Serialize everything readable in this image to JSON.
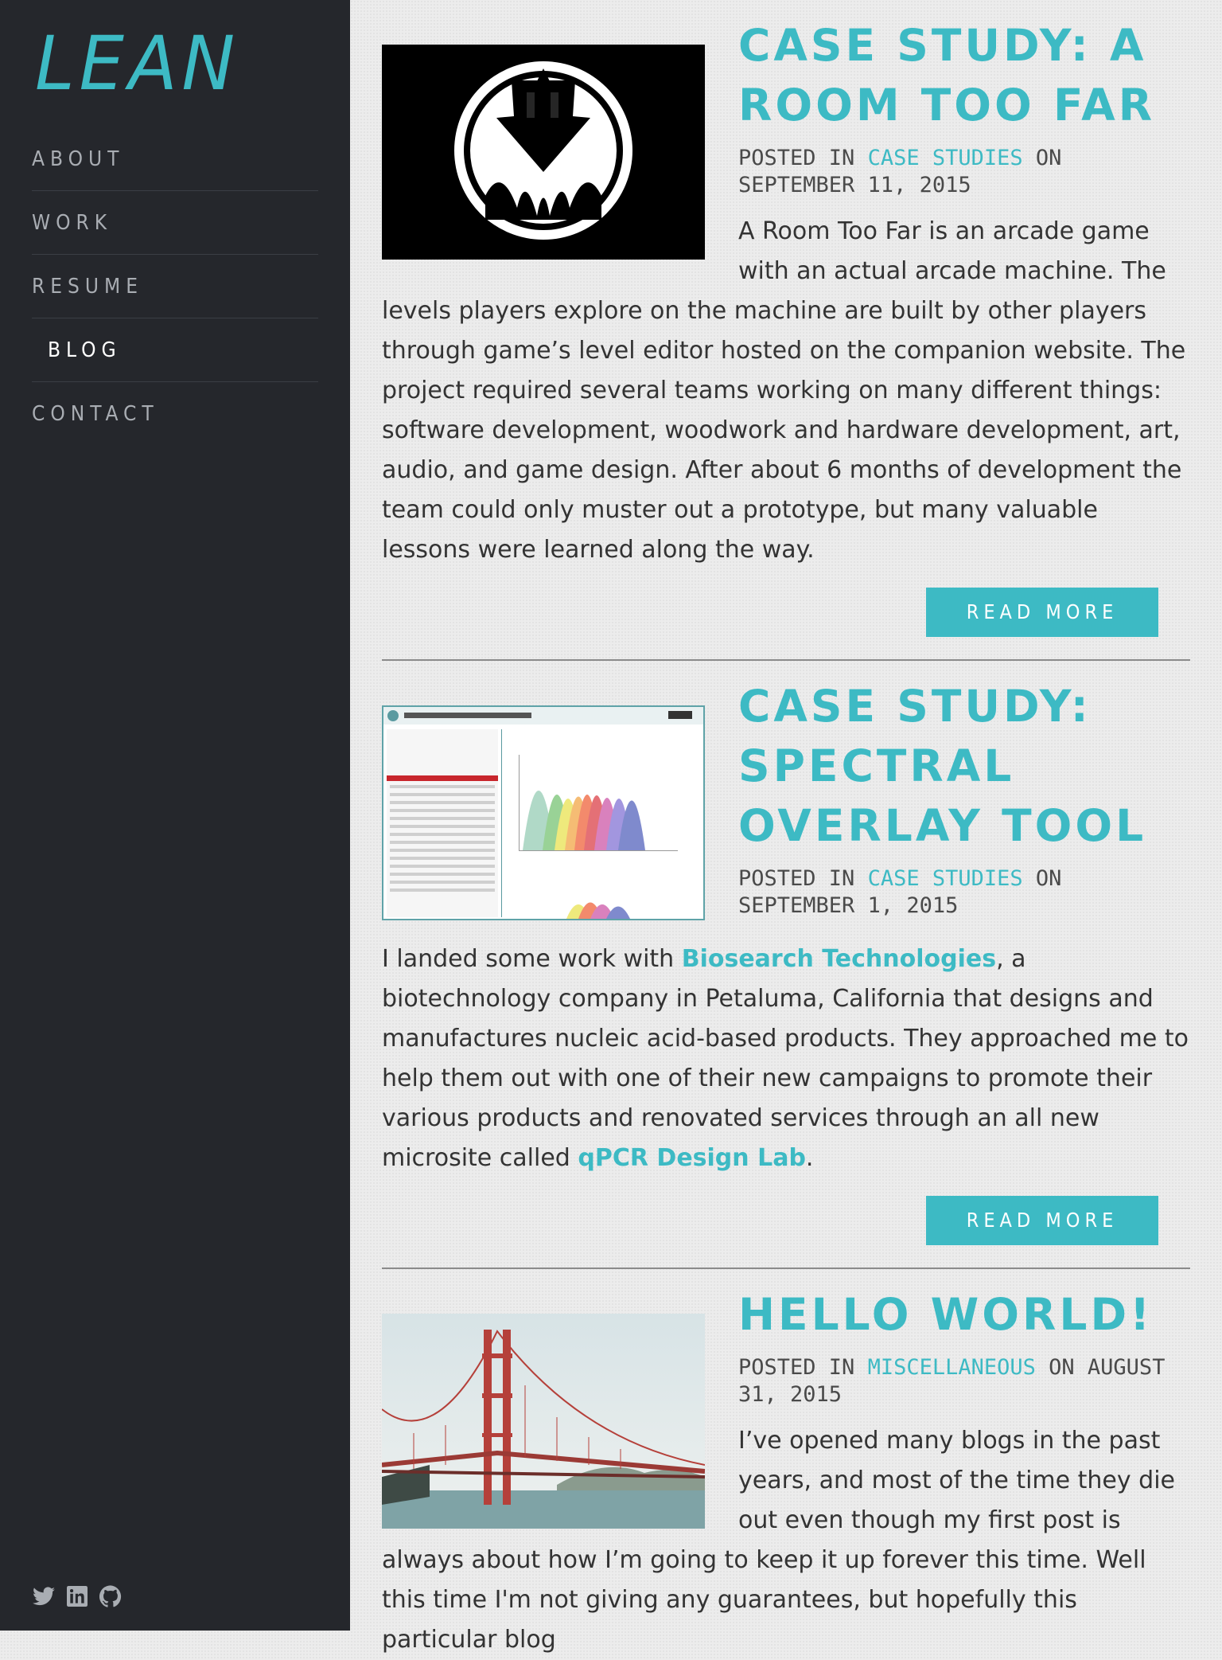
{
  "site": {
    "logo": "LEAN"
  },
  "nav": [
    {
      "label": "ABOUT"
    },
    {
      "label": "WORK"
    },
    {
      "label": "RESUME"
    },
    {
      "label": "BLOG",
      "active": true
    },
    {
      "label": "CONTACT"
    }
  ],
  "social": [
    "twitter-icon",
    "linkedin-icon",
    "github-icon"
  ],
  "posts": [
    {
      "title": "CASE STUDY: A ROOM TOO FAR",
      "meta_prefix": "POSTED IN ",
      "category": "CASE STUDIES",
      "meta_mid": " ON SEPTEMBER 11, 2015",
      "excerpt": "A Room Too Far is an arcade game with an actual arcade machine. The levels players explore on the machine are built by other players through game’s level editor hosted on the companion website. The project required several teams working on many different things: software development, woodwork and hardware development, art, audio, and game design. After about 6 months of development the team could only muster out a prototype, but many valuable lessons were learned along the way.",
      "read_more": "READ MORE"
    },
    {
      "title": "CASE STUDY: SPECTRAL OVERLAY TOOL",
      "meta_prefix": "POSTED IN ",
      "category": "CASE STUDIES",
      "meta_mid": " ON SEPTEMBER 1, 2015",
      "excerpt_a": "I landed some work with ",
      "link1": "Biosearch Technologies",
      "excerpt_b": ", a biotechnology company in Petaluma, California that designs and manufactures nucleic acid-based products. They approached me to help them out with one of their new campaigns to promote their various products and renovated services through an all new microsite called ",
      "link2": "qPCR Design Lab",
      "excerpt_c": ".",
      "read_more": "READ MORE"
    },
    {
      "title": "HELLO WORLD!",
      "meta_prefix": "POSTED IN ",
      "category": "MISCELLANEOUS",
      "meta_mid": " ON AUGUST 31, 2015",
      "excerpt": "I’ve opened many blogs in the past years, and most of the time they die out even though my first post is always about how I’m going to keep it up forever this time. Well this time I'm not giving any guarantees, but hopefully this particular blog"
    }
  ],
  "colors": {
    "accent": "#3dbac4",
    "sidebar": "#25272c",
    "background": "#ececec"
  }
}
